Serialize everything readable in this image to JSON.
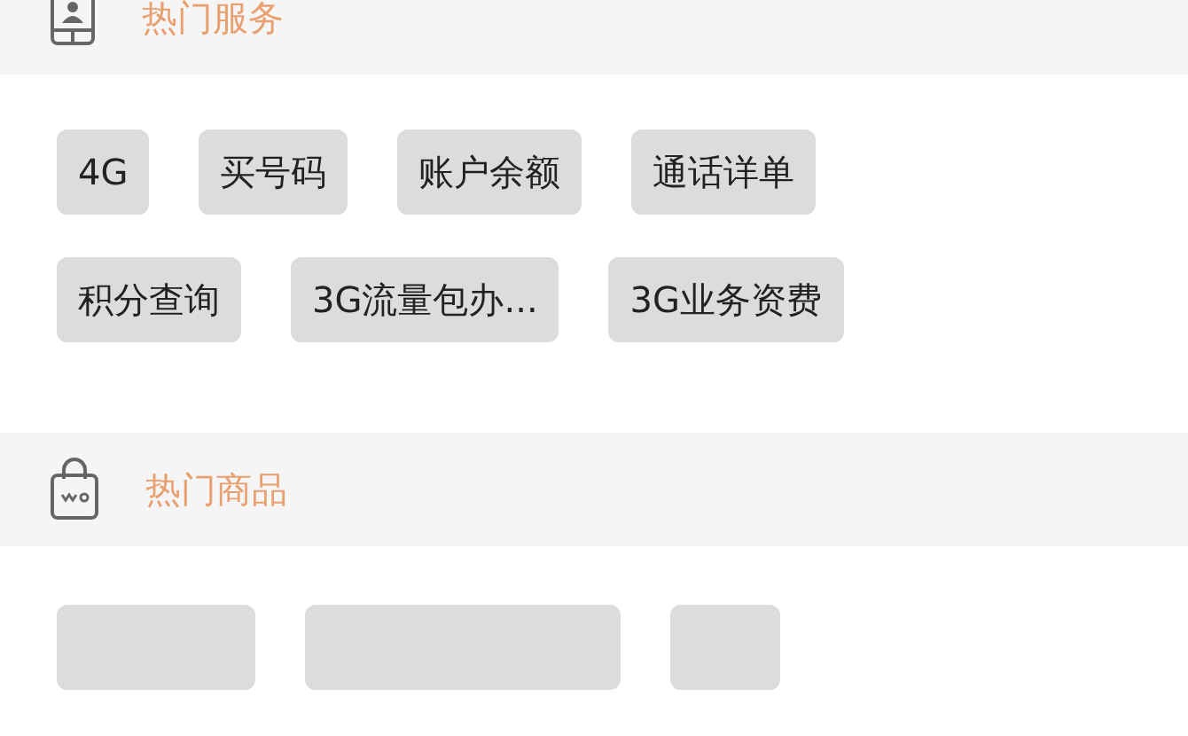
{
  "sections": [
    {
      "title": "热门服务",
      "tags": [
        {
          "kind": "tag",
          "label": "4G"
        },
        {
          "kind": "tag",
          "label": "买号码"
        },
        {
          "kind": "tag",
          "label": "账户余额"
        },
        {
          "kind": "tag",
          "label": "通话详单"
        },
        {
          "kind": "tag",
          "label": "积分查询"
        },
        {
          "kind": "tag",
          "label": "3G流量包办..."
        },
        {
          "kind": "tag",
          "label": "3G业务资费"
        }
      ]
    },
    {
      "title": "热门商品",
      "tags": [
        {
          "kind": "cut"
        },
        {
          "kind": "cut"
        },
        {
          "kind": "cut"
        }
      ]
    }
  ]
}
